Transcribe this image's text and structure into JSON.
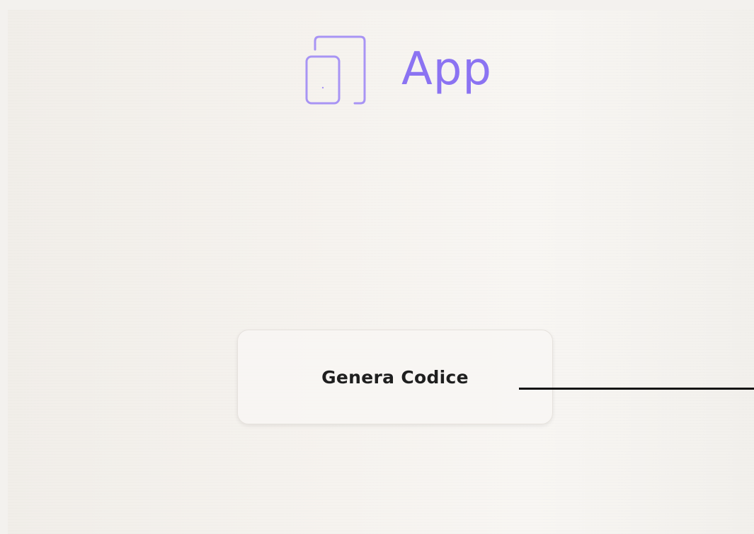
{
  "app": {
    "title": "App",
    "accent_color": "#8b73f2",
    "logo_icon": "devices-icon"
  },
  "main": {
    "generate_button_label": "Genera Codice"
  }
}
